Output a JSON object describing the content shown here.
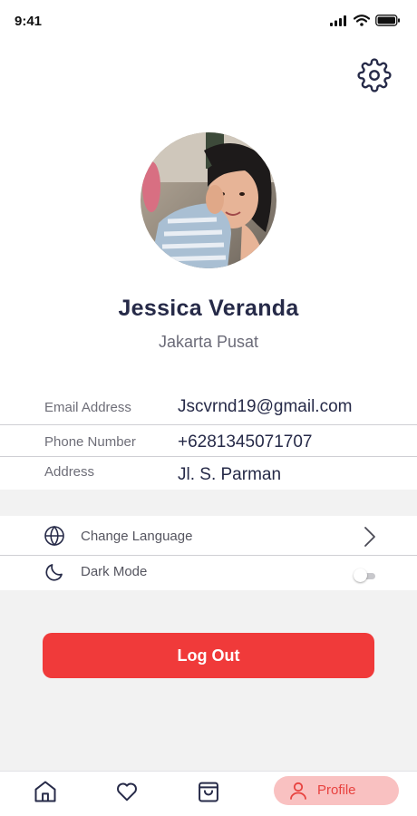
{
  "status_bar": {
    "time": "9:41"
  },
  "profile": {
    "name": "Jessica Veranda",
    "location": "Jakarta Pusat"
  },
  "info": [
    {
      "label": "Email Address",
      "value": "Jscvrnd19@gmail.com"
    },
    {
      "label": "Phone Number",
      "value": "+6281345071707"
    },
    {
      "label": "Address",
      "value": "Jl. S. Parman"
    }
  ],
  "settings": {
    "change_language": "Change Language",
    "dark_mode": "Dark Mode",
    "dark_mode_enabled": false
  },
  "actions": {
    "logout_label": "Log Out"
  },
  "bottom_nav": {
    "items": [
      {
        "icon": "home-icon"
      },
      {
        "icon": "heart-icon"
      },
      {
        "icon": "shopping-bag-icon"
      },
      {
        "icon": "user-icon",
        "label": "Profile",
        "active": true
      }
    ]
  },
  "colors": {
    "accent": "#f03a3a",
    "active_nav_bg": "#f9c1c1",
    "heading": "#262a48"
  }
}
